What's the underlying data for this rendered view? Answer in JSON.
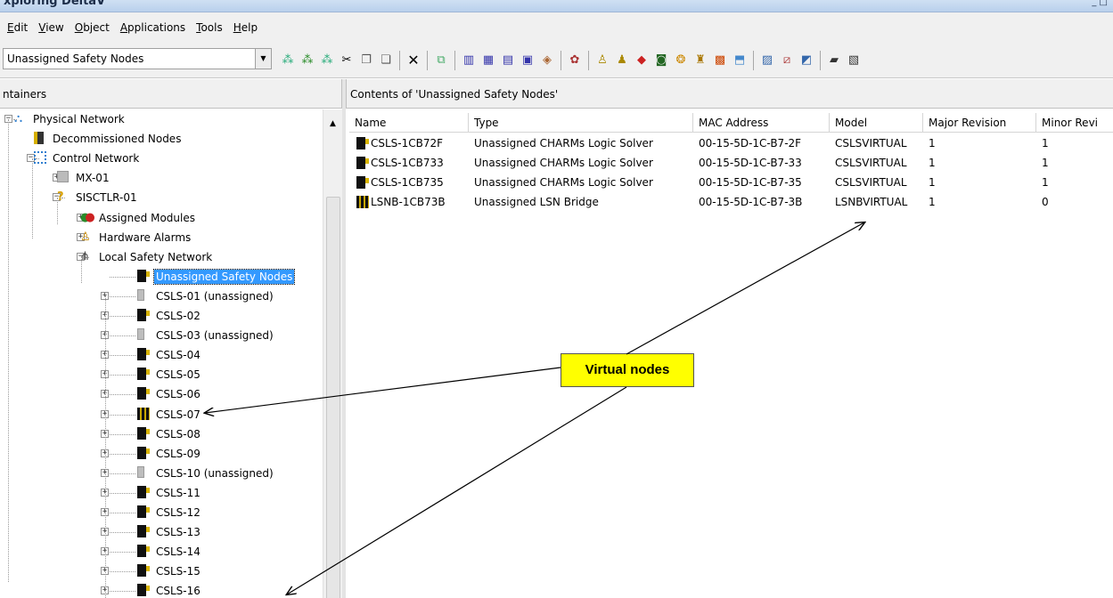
{
  "window": {
    "title": "xploring DeltaV",
    "controls": "_ □"
  },
  "menu": {
    "items": [
      "Edit",
      "View",
      "Object",
      "Applications",
      "Tools",
      "Help"
    ]
  },
  "toolbar": {
    "combo_value": "Unassigned Safety Nodes",
    "combo_arrow": "▼"
  },
  "left_pane": {
    "header": "ntainers"
  },
  "right_pane": {
    "header": "Contents of 'Unassigned Safety Nodes'"
  },
  "tree": {
    "nodes": [
      {
        "label": "Physical Network",
        "icon": "network-icon"
      },
      {
        "label": "Decommissioned Nodes",
        "icon": "decommissioned-nodes-icon"
      },
      {
        "label": "Control Network",
        "icon": "control-network-icon"
      },
      {
        "label": "MX-01",
        "icon": "controller-icon"
      },
      {
        "label": "SISCTLR-01",
        "icon": "sis-controller-icon"
      },
      {
        "label": "Assigned Modules",
        "icon": "modules-icon"
      },
      {
        "label": "Hardware Alarms",
        "icon": "alarm-icon"
      },
      {
        "label": "Local Safety Network",
        "icon": "safety-network-icon"
      },
      {
        "label": "Unassigned Safety Nodes",
        "icon": "csls-icon"
      },
      {
        "label": "CSLS-01 (unassigned)",
        "icon": "csls-unassigned-icon"
      },
      {
        "label": "CSLS-02",
        "icon": "csls-icon"
      },
      {
        "label": "CSLS-03 (unassigned)",
        "icon": "csls-unassigned-icon"
      },
      {
        "label": "CSLS-04",
        "icon": "csls-icon"
      },
      {
        "label": "CSLS-05",
        "icon": "csls-icon"
      },
      {
        "label": "CSLS-06",
        "icon": "csls-icon"
      },
      {
        "label": "CSLS-07",
        "icon": "lsnb-icon"
      },
      {
        "label": "CSLS-08",
        "icon": "csls-icon"
      },
      {
        "label": "CSLS-09",
        "icon": "csls-icon"
      },
      {
        "label": "CSLS-10 (unassigned)",
        "icon": "csls-unassigned-icon"
      },
      {
        "label": "CSLS-11",
        "icon": "csls-icon"
      },
      {
        "label": "CSLS-12",
        "icon": "csls-icon"
      },
      {
        "label": "CSLS-13",
        "icon": "csls-icon"
      },
      {
        "label": "CSLS-14",
        "icon": "csls-icon"
      },
      {
        "label": "CSLS-15",
        "icon": "csls-icon"
      },
      {
        "label": "CSLS-16",
        "icon": "csls-icon"
      }
    ]
  },
  "list": {
    "columns": [
      "Name",
      "Type",
      "MAC Address",
      "Model",
      "Major Revision",
      "Minor Revi"
    ],
    "rows": [
      {
        "icon": "csls-icon",
        "cells": [
          "CSLS-1CB72F",
          "Unassigned CHARMs Logic Solver",
          "00-15-5D-1C-B7-2F",
          "CSLSVIRTUAL",
          "1",
          "1"
        ]
      },
      {
        "icon": "csls-icon",
        "cells": [
          "CSLS-1CB733",
          "Unassigned CHARMs Logic Solver",
          "00-15-5D-1C-B7-33",
          "CSLSVIRTUAL",
          "1",
          "1"
        ]
      },
      {
        "icon": "csls-icon",
        "cells": [
          "CSLS-1CB735",
          "Unassigned CHARMs Logic Solver",
          "00-15-5D-1C-B7-35",
          "CSLSVIRTUAL",
          "1",
          "1"
        ]
      },
      {
        "icon": "lsnb-icon",
        "cells": [
          "LSNB-1CB73B",
          "Unassigned LSN Bridge",
          "00-15-5D-1C-B7-3B",
          "LSNBVIRTUAL",
          "1",
          "0"
        ]
      }
    ]
  },
  "annotation": {
    "callout": "Virtual nodes"
  },
  "colors": {
    "selection": "#3399ff",
    "callout": "#ffff00"
  }
}
